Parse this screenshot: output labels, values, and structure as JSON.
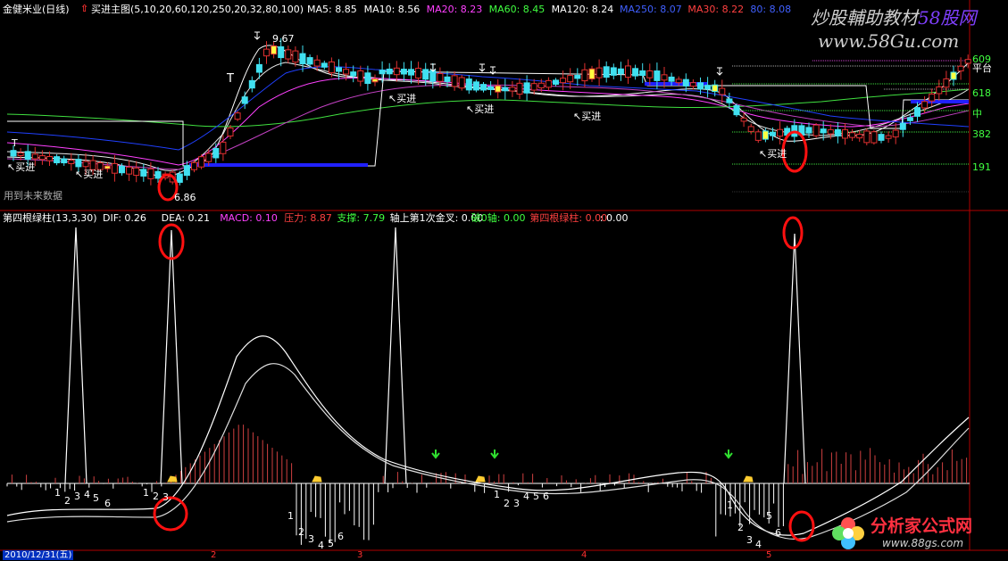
{
  "watermark_top": {
    "line1": "炒股輔助教材",
    "brand": "58股网",
    "url": "www.58Gu.com"
  },
  "watermark_bottom": {
    "brand": "分析家公式网",
    "url": "www.88gs.com"
  },
  "main_header": {
    "stock": "金健米业(日线)",
    "indicator": "买进主图(5,10,20,60,120,250,20,32,80,100)",
    "items": [
      {
        "label": "MA5: 8.85",
        "color": "#ffffff"
      },
      {
        "label": "MA10: 8.56",
        "color": "#ffffff"
      },
      {
        "label": "MA20: 8.23",
        "color": "#ff40ff"
      },
      {
        "label": "MA60: 8.45",
        "color": "#40ff40"
      },
      {
        "label": "MA120: 8.24",
        "color": "#ffffff"
      },
      {
        "label": "MA250: 8.07",
        "color": "#4060ff"
      },
      {
        "label": "MA30: 8.22",
        "color": "#ff4040"
      },
      {
        "label": "80: 8.08",
        "color": "#4060ff"
      }
    ]
  },
  "price_axis": [
    "609",
    "平台",
    "618",
    "中",
    "382",
    "191"
  ],
  "price_labels": {
    "high": "9.67",
    "low": "6.86",
    "future_note": "用到未来数据",
    "t1": "T",
    "t2": "T"
  },
  "buy_signals": [
    "买进",
    "买进",
    "买进",
    "买进",
    "买进",
    "买进",
    "买进"
  ],
  "sub_header": {
    "title": "第四根绿柱(13,3,30)",
    "items": [
      {
        "label": "DIF: 0.26",
        "color": "#ffffff"
      },
      {
        "label": "DEA: 0.21",
        "color": "#ffffff"
      },
      {
        "label": "MACD: 0.10",
        "color": "#ff40ff"
      },
      {
        "label": "压力: 8.87",
        "color": "#ff4040"
      },
      {
        "label": "支撑: 7.79",
        "color": "#40ff40"
      },
      {
        "label": "轴上第1次金叉: 0.00",
        "color": "#ffffff"
      },
      {
        "label": "破0轴: 0.00",
        "color": "#40ff40"
      },
      {
        "label": "第四根绿柱: 0.00",
        "color": "#ff4040"
      },
      {
        "label": ": 0.00",
        "color": "#ffffff"
      }
    ]
  },
  "count_labels": {
    "g1": [
      "1",
      "2",
      "3",
      "4",
      "5",
      "6"
    ],
    "g2": [
      "1",
      "2",
      "3"
    ],
    "g3": [
      "1",
      "2",
      "3",
      "4",
      "5",
      "6"
    ],
    "g4": [
      "1",
      "2",
      "3",
      "4",
      "5",
      "6"
    ],
    "g5": [
      "1",
      "2",
      "3",
      "4",
      "5",
      "6"
    ]
  },
  "date_axis": {
    "first": "2010/12/31(五)",
    "months": [
      "2",
      "3",
      "4",
      "5"
    ]
  },
  "colors": {
    "background": "#000000",
    "axis_red": "#b00000",
    "bar_up": "#e03030",
    "bar_down": "#40e0f0",
    "ma250": "#2040ff",
    "ellipse": "#ff1010"
  }
}
